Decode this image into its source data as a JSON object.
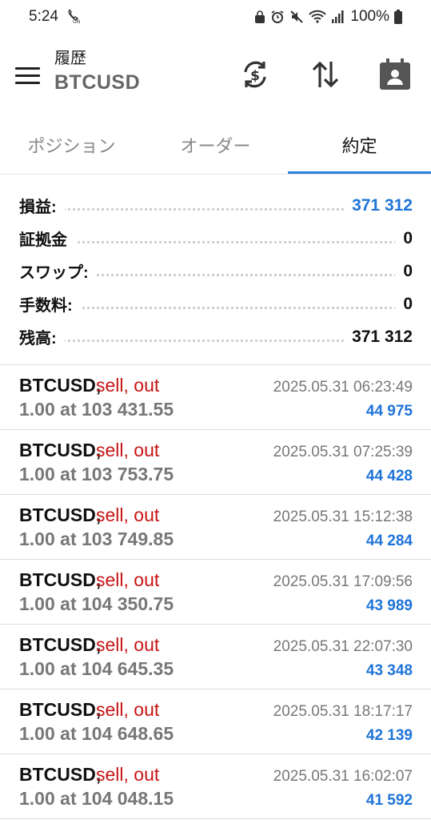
{
  "status_bar": {
    "time": "5:24",
    "battery": "100%",
    "icons": [
      "call-forwarding-icon",
      "lock-icon",
      "alarm-icon",
      "mute-icon",
      "wifi-icon",
      "signal-icon",
      "battery-icon"
    ]
  },
  "header": {
    "title": "履歴",
    "symbol": "BTCUSD",
    "icons": [
      "menu-icon",
      "currency-refresh-icon",
      "sort-icon",
      "contact-calendar-icon"
    ]
  },
  "tabs": [
    {
      "label": "ポジション",
      "active": false
    },
    {
      "label": "オーダー",
      "active": false
    },
    {
      "label": "約定",
      "active": true
    }
  ],
  "summary": [
    {
      "label": "損益:",
      "value": "371 312",
      "color": "#1e73d8"
    },
    {
      "label": "証拠金",
      "value": "0"
    },
    {
      "label": "スワップ:",
      "value": "0"
    },
    {
      "label": "手数料:",
      "value": "0"
    },
    {
      "label": "残高:",
      "value": "371 312"
    }
  ],
  "deals": [
    {
      "symbol": "BTCUSD,",
      "side": "sell, out",
      "price": "1.00 at 103 431.55",
      "time": "2025.05.31 06:23:49",
      "profit": "44 975"
    },
    {
      "symbol": "BTCUSD,",
      "side": "sell, out",
      "price": "1.00 at 103 753.75",
      "time": "2025.05.31 07:25:39",
      "profit": "44 428"
    },
    {
      "symbol": "BTCUSD,",
      "side": "sell, out",
      "price": "1.00 at 103 749.85",
      "time": "2025.05.31 15:12:38",
      "profit": "44 284"
    },
    {
      "symbol": "BTCUSD,",
      "side": "sell, out",
      "price": "1.00 at 104 350.75",
      "time": "2025.05.31 17:09:56",
      "profit": "43 989"
    },
    {
      "symbol": "BTCUSD,",
      "side": "sell, out",
      "price": "1.00 at 104 645.35",
      "time": "2025.05.31 22:07:30",
      "profit": "43 348"
    },
    {
      "symbol": "BTCUSD,",
      "side": "sell, out",
      "price": "1.00 at 104 648.65",
      "time": "2025.05.31 18:17:17",
      "profit": "42 139"
    },
    {
      "symbol": "BTCUSD,",
      "side": "sell, out",
      "price": "1.00 at 104 048.15",
      "time": "2025.05.31 16:02:07",
      "profit": "41 592"
    }
  ],
  "colors": {
    "accent": "#2a80d8",
    "profit": "#1e73d8",
    "sell": "#c81414"
  }
}
